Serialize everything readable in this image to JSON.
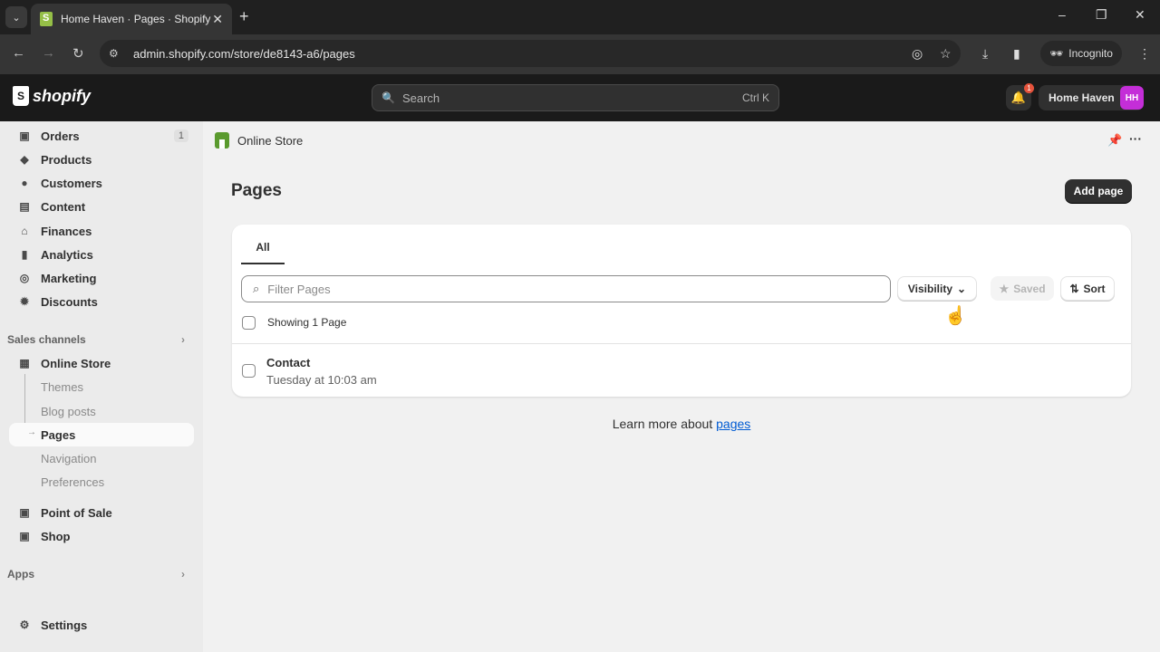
{
  "browser": {
    "tab_title": "Home Haven · Pages · Shopify",
    "tab_close": "✕",
    "new_tab": "+",
    "url": "admin.shopify.com/store/de8143-a6/pages",
    "incognito_label": "Incognito",
    "window_controls": {
      "minimize": "–",
      "restore": "❐",
      "close": "✕"
    }
  },
  "topbar": {
    "logo_text": "shopify",
    "search_placeholder": "Search",
    "search_shortcut": "Ctrl K",
    "notification_count": "1",
    "store_name": "Home Haven",
    "avatar_initials": "HH",
    "avatar_color": "#c42ed8"
  },
  "sidebar": {
    "items": [
      {
        "label": "Orders",
        "icon": "inbox-icon",
        "count": "1"
      },
      {
        "label": "Products",
        "icon": "tag-icon"
      },
      {
        "label": "Customers",
        "icon": "person-icon"
      },
      {
        "label": "Content",
        "icon": "image-icon"
      },
      {
        "label": "Finances",
        "icon": "bank-icon"
      },
      {
        "label": "Analytics",
        "icon": "bar-chart-icon"
      },
      {
        "label": "Marketing",
        "icon": "target-icon"
      },
      {
        "label": "Discounts",
        "icon": "discount-icon"
      }
    ],
    "sales_channels_label": "Sales channels",
    "online_store_label": "Online Store",
    "online_store_sub": [
      {
        "label": "Themes"
      },
      {
        "label": "Blog posts"
      },
      {
        "label": "Pages",
        "active": true
      },
      {
        "label": "Navigation"
      },
      {
        "label": "Preferences"
      }
    ],
    "point_of_sale_label": "Point of Sale",
    "shop_label": "Shop",
    "apps_label": "Apps",
    "settings_label": "Settings"
  },
  "main": {
    "breadcrumb": "Online Store",
    "page_title": "Pages",
    "add_page_label": "Add page",
    "tabs": [
      {
        "label": "All",
        "selected": true
      }
    ],
    "filter_placeholder": "Filter Pages",
    "visibility_label": "Visibility",
    "saved_label": "Saved",
    "sort_label": "Sort",
    "showing_text": "Showing 1 Page",
    "rows": [
      {
        "title": "Contact",
        "subtitle": "Tuesday at 10:03 am"
      }
    ],
    "learn_more_prefix": "Learn more about ",
    "learn_more_link": "pages"
  }
}
